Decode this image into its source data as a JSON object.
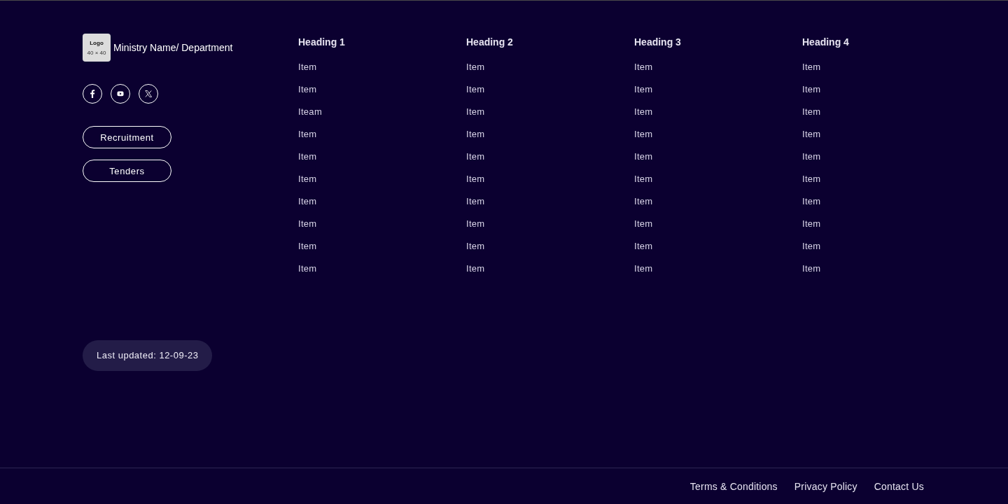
{
  "brand": {
    "logo": {
      "label": "Logo",
      "size": "40 × 40"
    },
    "name": "Ministry Name/ Department"
  },
  "social_links": [
    {
      "kind": "facebook"
    },
    {
      "kind": "youtube"
    },
    {
      "kind": "x"
    }
  ],
  "buttons": [
    "Recruitment",
    "Tenders"
  ],
  "columns": [
    {
      "heading": "Heading 1",
      "items": [
        "Item",
        "Item",
        "Iteam",
        "Item",
        "Item",
        "Item",
        "Item",
        "Item",
        "Item",
        "Item"
      ]
    },
    {
      "heading": "Heading 2",
      "items": [
        "Item",
        "Item",
        "Item",
        "Item",
        "Item",
        "Item",
        "Item",
        "Item",
        "Item",
        "Item"
      ]
    },
    {
      "heading": "Heading 3",
      "items": [
        "Item",
        "Item",
        "Item",
        "Item",
        "Item",
        "Item",
        "Item",
        "Item",
        "Item",
        "Item"
      ]
    },
    {
      "heading": "Heading 4",
      "items": [
        "Item",
        "Item",
        "Item",
        "Item",
        "Item",
        "Item",
        "Item",
        "Item",
        "Item",
        "Item"
      ]
    }
  ],
  "last_updated": "Last updated: 12-09-23",
  "bottom_links": [
    "Terms & Conditions",
    "Privacy Policy",
    "Contact Us"
  ]
}
